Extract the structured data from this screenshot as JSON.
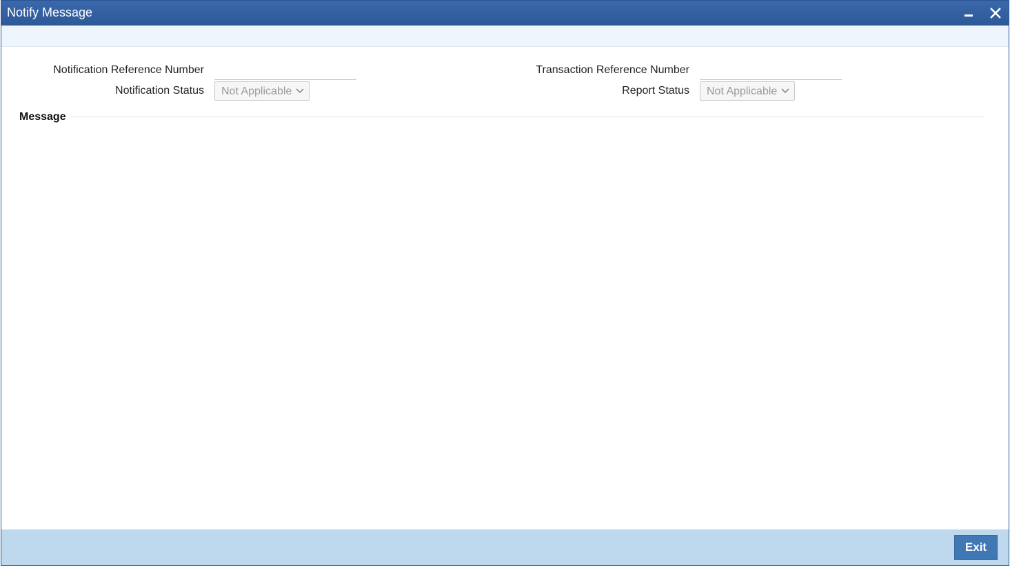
{
  "window": {
    "title": "Notify Message"
  },
  "form": {
    "notification_reference_label": "Notification Reference Number",
    "notification_reference_value": "",
    "transaction_reference_label": "Transaction Reference Number",
    "transaction_reference_value": "",
    "notification_status_label": "Notification Status",
    "notification_status_value": "Not Applicable",
    "report_status_label": "Report Status",
    "report_status_value": "Not Applicable"
  },
  "message_section": {
    "title": "Message"
  },
  "footer": {
    "exit_label": "Exit"
  },
  "icons": {
    "minimize": "minimize-icon",
    "close": "close-icon",
    "dropdown": "chevron-down-icon"
  },
  "colors": {
    "titlebar": "#2d5998",
    "toolbar_strip": "#eef5fd",
    "footer": "#bed8ee",
    "exit_button": "#3f78b4"
  }
}
